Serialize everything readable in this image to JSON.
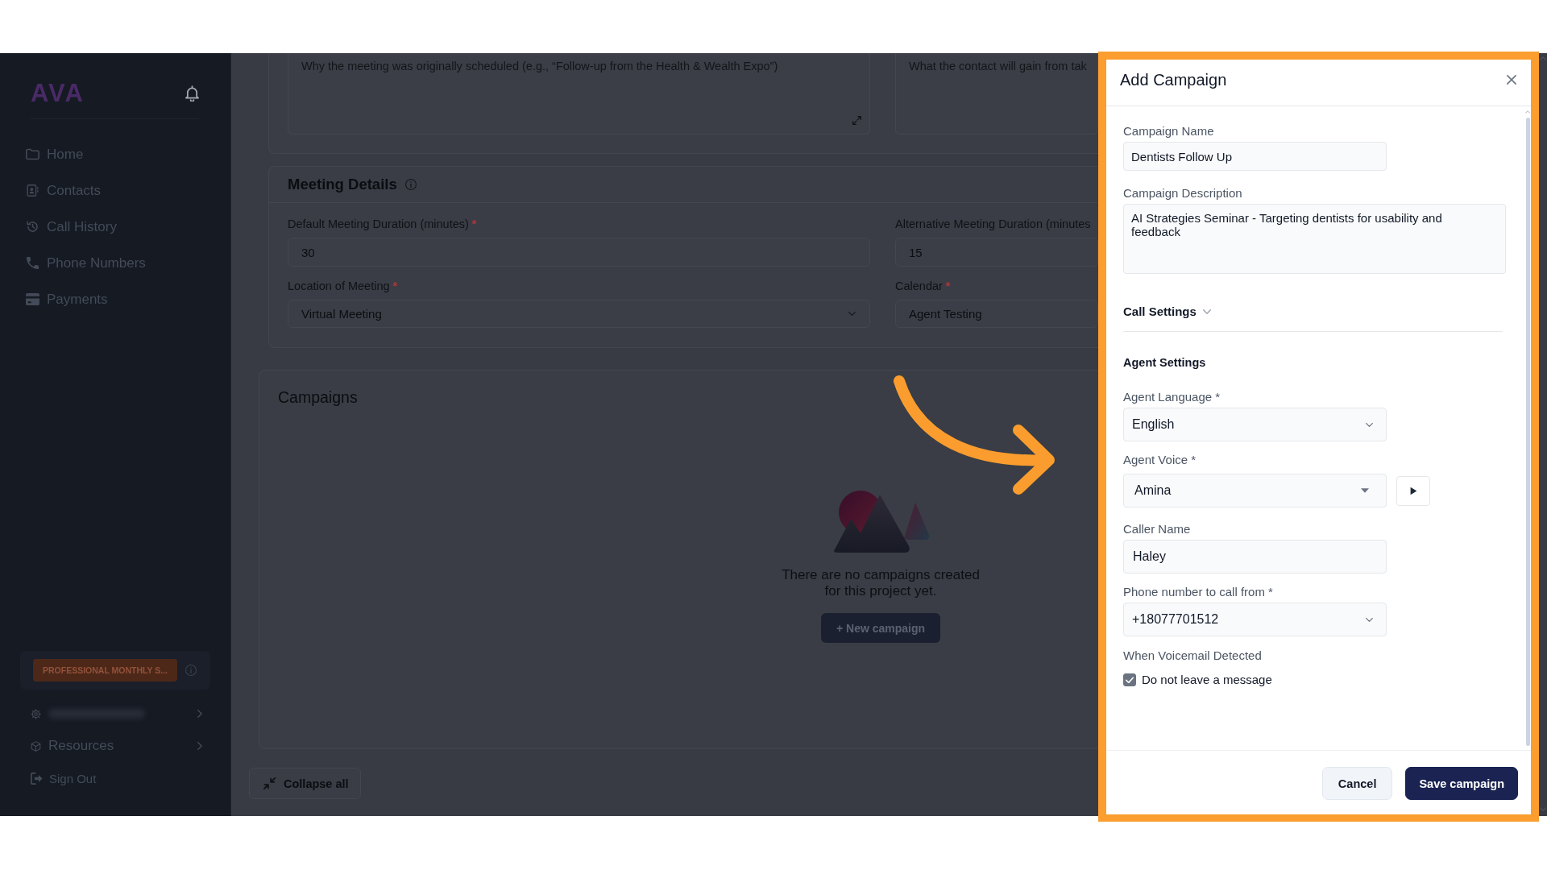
{
  "sidebar": {
    "logo": "AVA",
    "nav_items": [
      {
        "label": "Home",
        "selected": false
      },
      {
        "label": "Contacts",
        "selected": false
      },
      {
        "label": "Call History",
        "selected": false
      },
      {
        "label": "Phone Numbers",
        "selected": false
      },
      {
        "label": "Payments",
        "selected": false
      }
    ],
    "plan_badge": "PROFESSIONAL MONTHLY S...",
    "bottom_items": [
      {
        "kind": "redacted"
      },
      {
        "kind": "menu",
        "label": "Resources"
      }
    ],
    "sign_out": "Sign Out"
  },
  "main": {
    "goal_fields": [
      {
        "placeholder": "Why the meeting was originally scheduled (e.g., “Follow-up from the Health & Wealth Expo”)"
      },
      {
        "placeholder": "What the contact will gain from tak"
      }
    ],
    "meeting_details": {
      "title": "Meeting Details",
      "fields": [
        {
          "kind": "input",
          "label": "Default Meeting Duration (minutes)",
          "required_mark": "*",
          "value": "30"
        },
        {
          "kind": "input",
          "label": "Alternative Meeting Duration (minutes",
          "value": "15"
        },
        {
          "kind": "select",
          "label": "Location of Meeting",
          "required_mark": "*",
          "value": "Virtual Meeting"
        },
        {
          "kind": "select",
          "label": "Calendar",
          "required_mark": "*",
          "value": "Agent Testing"
        }
      ]
    },
    "campaigns": {
      "title": "Campaigns",
      "empty_message": "There are no campaigns created for this project yet.",
      "new_button": "+ New campaign"
    },
    "collapse_button": "Collapse all"
  },
  "drawer": {
    "title": "Add Campaign",
    "fields": [
      {
        "kind": "input",
        "label": "Campaign Name",
        "value": "Dentists Follow Up"
      },
      {
        "kind": "textarea",
        "label": "Campaign Description",
        "value": "AI Strategies Seminar - Targeting dentists for usability and feedback"
      }
    ],
    "call_settings": {
      "title": "Call Settings"
    },
    "agent_settings": {
      "title": "Agent Settings",
      "fields": [
        {
          "kind": "select",
          "label": "Agent Language *",
          "value": "English"
        },
        {
          "kind": "voice_select",
          "label": "Agent Voice *",
          "value": "Amina"
        },
        {
          "kind": "input",
          "label": "Caller Name",
          "value": "Haley"
        },
        {
          "kind": "select",
          "label": "Phone number to call from *",
          "value": "+18077701512"
        }
      ],
      "voicemail": {
        "label": "When Voicemail Detected",
        "option": {
          "label": "Do not leave a message",
          "checked": true
        }
      }
    },
    "buttons": [
      {
        "kind": "secondary",
        "label": "Cancel"
      },
      {
        "kind": "primary",
        "label": "Save campaign"
      }
    ]
  }
}
